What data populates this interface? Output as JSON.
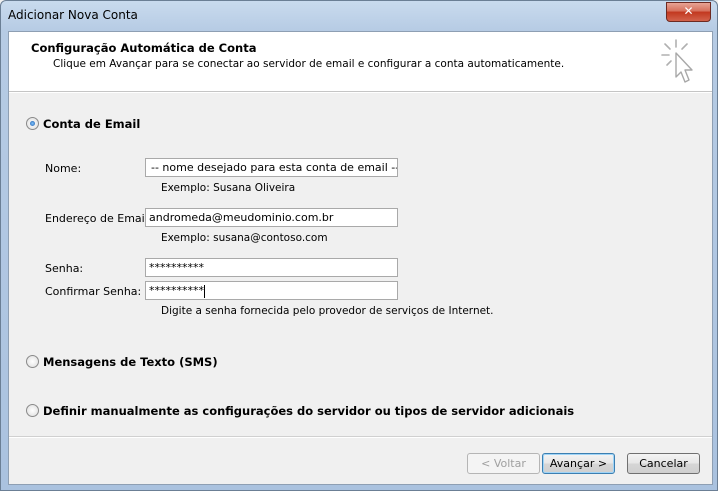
{
  "window": {
    "title": "Adicionar Nova Conta",
    "close_glyph": "✕"
  },
  "header": {
    "title": "Configuração Automática de Conta",
    "subtitle": "Clique em Avançar para se conectar ao servidor de email e configurar a conta automaticamente."
  },
  "options": {
    "email_account": {
      "label": "Conta de Email",
      "selected": true
    },
    "sms": {
      "label": "Mensagens de Texto (SMS)",
      "selected": false
    },
    "manual": {
      "label": "Definir manualmente as configurações do servidor ou tipos de servidor adicionais",
      "selected": false
    }
  },
  "form": {
    "name": {
      "label": "Nome:",
      "value": "-- nome desejado para esta conta de email --",
      "hint": "Exemplo: Susana Oliveira"
    },
    "email": {
      "label": "Endereço de Email:",
      "value": "andromeda@meudominio.com.br",
      "hint": "Exemplo: susana@contoso.com"
    },
    "password": {
      "label": "Senha:",
      "value": "**********"
    },
    "confirm_password": {
      "label": "Confirmar Senha:",
      "value": "**********"
    },
    "password_hint": "Digite a senha fornecida pelo provedor de serviços de Internet."
  },
  "buttons": {
    "back": "< Voltar",
    "next": "Avançar >",
    "cancel": "Cancelar"
  }
}
